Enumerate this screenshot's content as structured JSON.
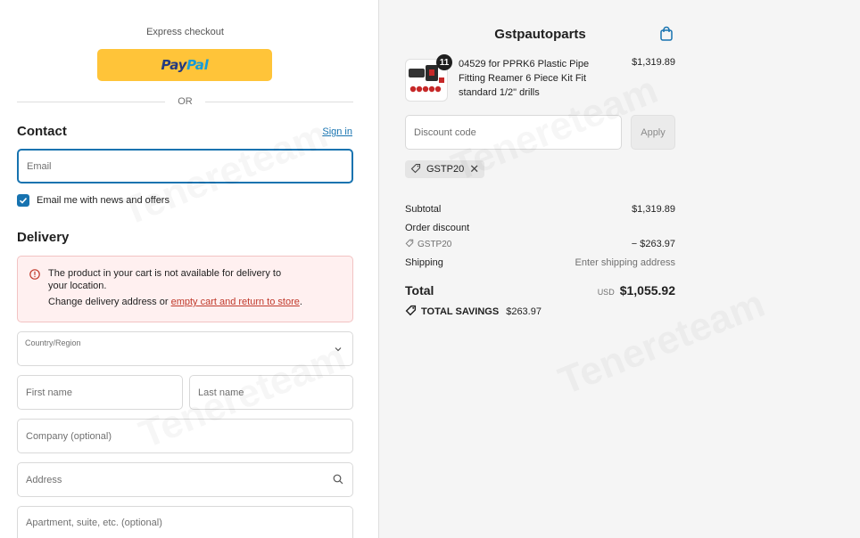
{
  "express": {
    "label": "Express checkout",
    "paypal_part1": "Pay",
    "paypal_part2": "Pal",
    "or": "OR"
  },
  "contact": {
    "heading": "Contact",
    "signin": "Sign in",
    "email_placeholder": "Email",
    "newsletter_label": "Email me with news and offers",
    "newsletter_checked": true
  },
  "delivery": {
    "heading": "Delivery",
    "error_title": "The product in your cart is not available for delivery to your location.",
    "error_body_prefix": "Change delivery address or ",
    "error_link": "empty cart and return to store",
    "error_body_suffix": ".",
    "country_label": "Country/Region",
    "first_name": "First name",
    "last_name": "Last name",
    "company": "Company (optional)",
    "address": "Address",
    "apartment": "Apartment, suite, etc. (optional)"
  },
  "summary": {
    "shop_name": "Gstpautoparts",
    "item": {
      "quantity": "11",
      "title": "04529 for PPRK6 Plastic Pipe Fitting Reamer 6 Piece Kit Fit standard 1/2\" drills",
      "price": "$1,319.89"
    },
    "discount_placeholder": "Discount code",
    "apply_label": "Apply",
    "applied_code": "GSTP20",
    "subtotal_label": "Subtotal",
    "subtotal_value": "$1,319.89",
    "order_discount_label": "Order discount",
    "discount_code_label": "GSTP20",
    "discount_value": "− $263.97",
    "shipping_label": "Shipping",
    "shipping_value": "Enter shipping address",
    "total_label": "Total",
    "currency": "USD",
    "total_value": "$1,055.92",
    "savings_label": "TOTAL SAVINGS",
    "savings_value": "$263.97"
  },
  "colors": {
    "accent": "#1773b0",
    "paypal_yellow": "#ffc439",
    "error_bg": "#fff0f0",
    "summary_bg": "#f5f5f5"
  },
  "watermark": "Tenereteam"
}
